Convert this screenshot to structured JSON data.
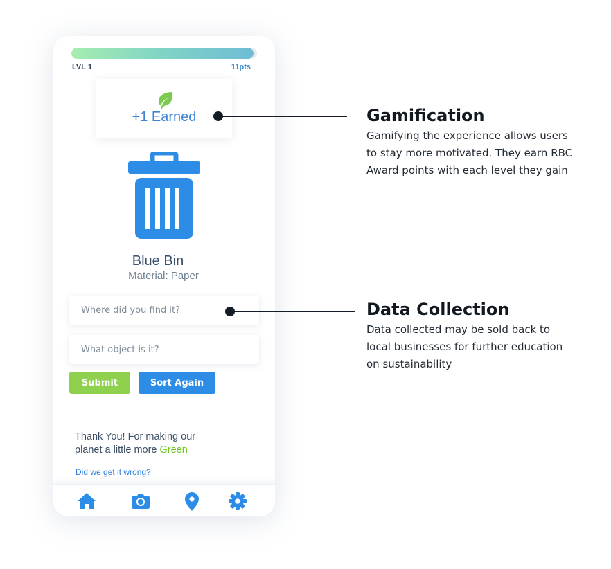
{
  "app": {
    "progress": {
      "level_label": "LVL 1",
      "points_label": "11pts",
      "fill_percent": 98
    },
    "earned_card": {
      "icon": "leaf-icon",
      "text": "+1 Earned"
    },
    "result": {
      "icon": "trash-bin-icon",
      "bin_name": "Blue Bin",
      "material": "Material: Paper"
    },
    "form": {
      "where_placeholder": "Where did you find it?",
      "what_placeholder": "What object is it?",
      "where_value": "",
      "what_value": ""
    },
    "buttons": {
      "submit_label": "Submit",
      "sort_again_label": "Sort Again"
    },
    "thanks": {
      "line_1": "Thank  You! For making our",
      "line_2_prefix": "planet a little more ",
      "line_2_highlight": "Green"
    },
    "wrong_link": "Did we get it wrong?",
    "nav": [
      "home-icon",
      "camera-icon",
      "location-pin-icon",
      "gear-icon"
    ]
  },
  "annotations": [
    {
      "title": "Gamification",
      "body": "Gamifying the experience allows users\nto stay more motivated. They earn RBC\nAward points with each level they gain"
    },
    {
      "title": "Data Collection",
      "body": "Data collected may be sold back to\nlocal businesses for further education\non sustainability"
    }
  ],
  "colors": {
    "primary_blue": "#2d8de6",
    "accent_green": "#8fd14f",
    "leaf_green": "#7dcb4e",
    "progress_gradient": [
      "#a6edb0",
      "#6fbcd4"
    ],
    "callout": "#141c26"
  }
}
